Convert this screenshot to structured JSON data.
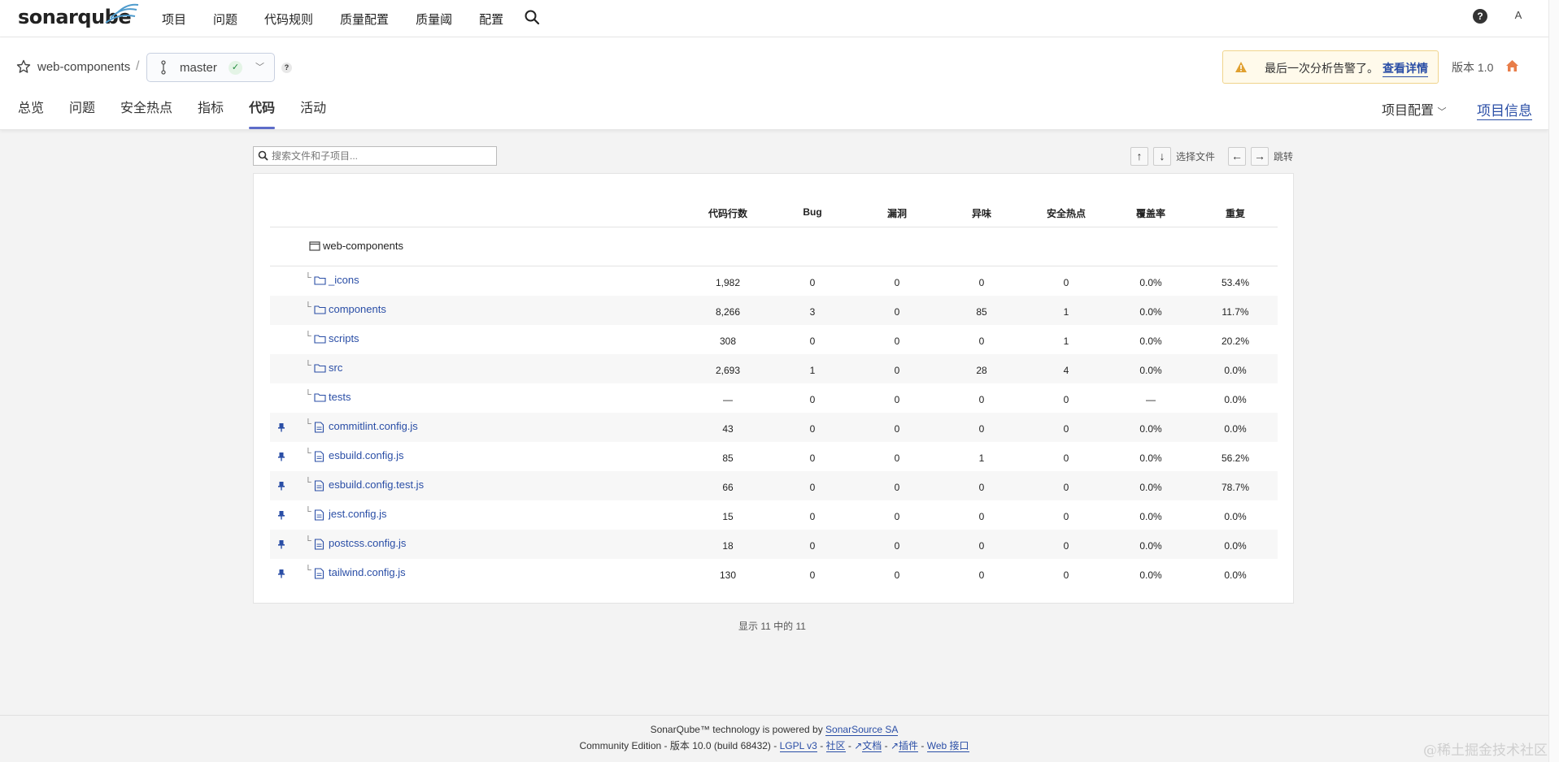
{
  "nav": {
    "logo": "sonarqube",
    "items": [
      "项目",
      "问题",
      "代码规则",
      "质量配置",
      "质量阈",
      "配置"
    ],
    "avatar": "A"
  },
  "project": {
    "name": "web-components",
    "branch": "master",
    "branch_help": "?",
    "warning_text": "最后一次分析告警了。",
    "warning_link": "查看详情",
    "version": "版本 1.0",
    "tabs": [
      "总览",
      "问题",
      "安全热点",
      "指标",
      "代码",
      "活动"
    ],
    "active_tab": "代码",
    "settings_label": "项目配置",
    "info_label": "项目信息"
  },
  "search": {
    "placeholder": "搜索文件和子项目..."
  },
  "keyboard": {
    "up": "↑",
    "down": "↓",
    "select_label": "选择文件",
    "left": "←",
    "right": "→",
    "jump_label": "跳转"
  },
  "table": {
    "columns": [
      "代码行数",
      "Bug",
      "漏洞",
      "异味",
      "安全热点",
      "覆盖率",
      "重复"
    ],
    "root_name": "web-components",
    "rows": [
      {
        "name": "_icons",
        "type": "folder",
        "values": [
          "1,982",
          "0",
          "0",
          "0",
          "0",
          "0.0%",
          "53.4%"
        ]
      },
      {
        "name": "components",
        "type": "folder",
        "values": [
          "8,266",
          "3",
          "0",
          "85",
          "1",
          "0.0%",
          "11.7%"
        ]
      },
      {
        "name": "scripts",
        "type": "folder",
        "values": [
          "308",
          "0",
          "0",
          "0",
          "1",
          "0.0%",
          "20.2%"
        ]
      },
      {
        "name": "src",
        "type": "folder",
        "values": [
          "2,693",
          "1",
          "0",
          "28",
          "4",
          "0.0%",
          "0.0%"
        ]
      },
      {
        "name": "tests",
        "type": "folder",
        "values": [
          "—",
          "0",
          "0",
          "0",
          "0",
          "—",
          "0.0%"
        ]
      },
      {
        "name": "commitlint.config.js",
        "type": "file",
        "values": [
          "43",
          "0",
          "0",
          "0",
          "0",
          "0.0%",
          "0.0%"
        ]
      },
      {
        "name": "esbuild.config.js",
        "type": "file",
        "values": [
          "85",
          "0",
          "0",
          "1",
          "0",
          "0.0%",
          "56.2%"
        ]
      },
      {
        "name": "esbuild.config.test.js",
        "type": "file",
        "values": [
          "66",
          "0",
          "0",
          "0",
          "0",
          "0.0%",
          "78.7%"
        ]
      },
      {
        "name": "jest.config.js",
        "type": "file",
        "values": [
          "15",
          "0",
          "0",
          "0",
          "0",
          "0.0%",
          "0.0%"
        ]
      },
      {
        "name": "postcss.config.js",
        "type": "file",
        "values": [
          "18",
          "0",
          "0",
          "0",
          "0",
          "0.0%",
          "0.0%"
        ]
      },
      {
        "name": "tailwind.config.js",
        "type": "file",
        "values": [
          "130",
          "0",
          "0",
          "0",
          "0",
          "0.0%",
          "0.0%"
        ]
      }
    ],
    "pager": "显示 11 中的 11"
  },
  "footer": {
    "line1_prefix": "SonarQube™ technology is powered by",
    "line1_link": "SonarSource SA",
    "edition": "Community Edition",
    "version": "版本 10.0 (build 68432)",
    "license": "LGPL v3",
    "community": "社区",
    "docs": "文档",
    "plugins": "插件",
    "web_api": "Web 接口"
  },
  "watermark": "@稀土掘金技术社区",
  "colors": {
    "link": "#2a4ea6",
    "active_tab_underline": "#5d6cc9",
    "warning_bg": "#fffaeb",
    "warning_border": "#f0d48c",
    "home_icon": "#e87d49"
  }
}
